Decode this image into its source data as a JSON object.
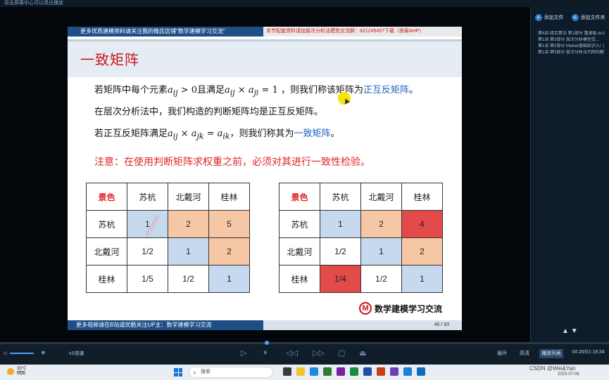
{
  "window": {
    "title": "双击屏幕中心可以退出播放"
  },
  "slide": {
    "top_left": "更多优质建模资料请关注我的微店店铺\"数学建模学习交流\"",
    "top_right": "本节配套资料请加层次分析法模型交流群：821245457下载（答案AHP）",
    "title": "一致矩阵",
    "line1_a": "若矩阵中每个元素",
    "line1_m1": "a",
    "line1_m1_sub": "ij",
    "line1_b": " > 0且满足",
    "line1_m2": "a",
    "line1_m2_sub": "ij",
    "line1_c": " × ",
    "line1_m3": "a",
    "line1_m3_sub": "ji",
    "line1_d": " = 1 ，则我们称该矩阵为",
    "line1_hl": "正互反矩阵",
    "line1_end": "。",
    "line2": "在层次分析法中，我们构造的判断矩阵均是正互反矩阵。",
    "line3_a": "若正互反矩阵满足",
    "line3_m1": "a",
    "line3_m1_sub": "ij",
    "line3_b": " × ",
    "line3_m2": "a",
    "line3_m2_sub": "jk",
    "line3_c": " = ",
    "line3_m3": "a",
    "line3_m3_sub": "ik",
    "line3_d": "，则我们称其为",
    "line3_hl": "一致矩阵",
    "line3_end": "。",
    "warning": "注意：在使用判断矩阵求权重之前，必须对其进行一致性检验。",
    "bottom_left": "更多视频请在B站或优酷关注UP主：数学建模学习交流",
    "page": "46 / 93",
    "logo_text": "数学建模学习交流",
    "logo_letter": "M",
    "watermark": "AT60ABE"
  },
  "table_left": {
    "header": [
      "景色",
      "苏杭",
      "北戴河",
      "桂林"
    ],
    "rows": [
      [
        "苏杭",
        "1",
        "2",
        "5"
      ],
      [
        "北戴河",
        "1/2",
        "1",
        "2"
      ],
      [
        "桂林",
        "1/5",
        "1/2",
        "1"
      ]
    ]
  },
  "table_right": {
    "header": [
      "景色",
      "苏杭",
      "北戴河",
      "桂林"
    ],
    "rows": [
      [
        "苏杭",
        "1",
        "2",
        "4"
      ],
      [
        "北戴河",
        "1/2",
        "1",
        "2"
      ],
      [
        "桂林",
        "1/4",
        "1/2",
        "1"
      ]
    ]
  },
  "sidebar": {
    "add_file": "添加文件",
    "add_folder": "添加文件夹",
    "files": [
      "第4讲 组合算法 第1部分 重录版.ev1",
      "第1讲 第2部分 层次分析模型交...",
      "第1讲 第2部分 Matlab基础知识入门",
      "第1讲 第3部分 层次分析法代码的解"
    ]
  },
  "controls": {
    "speed": "x1倍速",
    "loop": "循环",
    "hd": "高清",
    "playlist": "播放列表",
    "time": "34:26/01:18:34"
  },
  "taskbar": {
    "temp": "33°C",
    "weather": "晴朗",
    "search": "搜索",
    "watermark": "CSDN @Wei&Yan",
    "date": "2023-07-08"
  }
}
